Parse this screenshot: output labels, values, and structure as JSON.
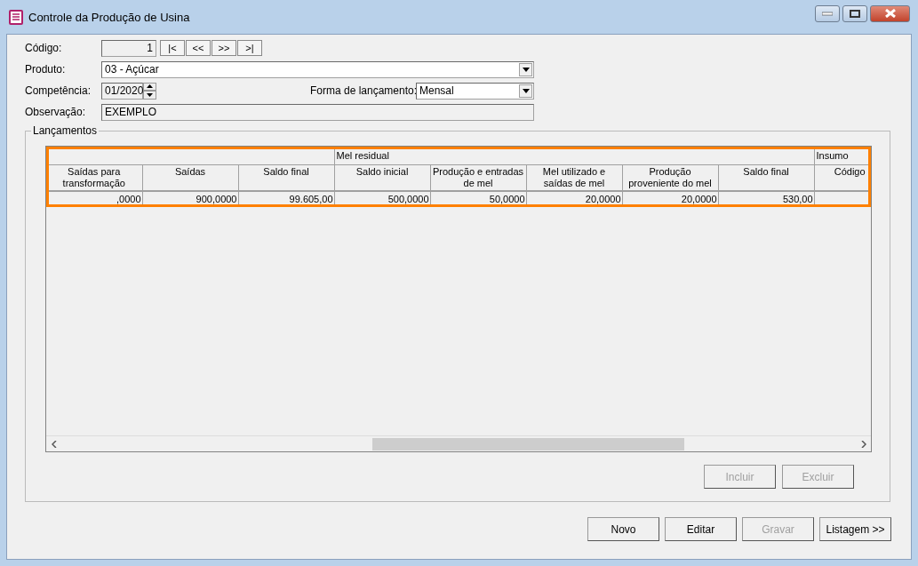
{
  "window": {
    "title": "Controle da Produção de Usina"
  },
  "form": {
    "codigo": {
      "label": "Código:",
      "value": "1",
      "nav": [
        "|<",
        "<<",
        ">>",
        ">|"
      ]
    },
    "produto": {
      "label": "Produto:",
      "value": "03 - Açúcar"
    },
    "competencia": {
      "label": "Competência:",
      "value": "01/2020"
    },
    "forma": {
      "label": "Forma de lançamento:",
      "value": "Mensal"
    },
    "observacao": {
      "label": "Observação:",
      "value": "EXEMPLO"
    }
  },
  "lancamentos": {
    "title": "Lançamentos",
    "groups": [
      {
        "label": "Mel residual"
      },
      {
        "label": "Insumo"
      }
    ],
    "columns": [
      "Saídas para transformação",
      "Saídas",
      "Saldo final",
      "Saldo inicial",
      "Produção e entradas de mel",
      "Mel utilizado e saídas de mel",
      "Produção proveniente do mel",
      "Saldo final",
      "Código"
    ],
    "rows": [
      [
        ",0000",
        "900,0000",
        "99.605,00",
        "500,0000",
        "50,0000",
        "20,0000",
        "20,0000",
        "530,00",
        ""
      ]
    ],
    "buttons": [
      {
        "label": "Incluir",
        "disabled": true
      },
      {
        "label": "Excluir",
        "disabled": true
      }
    ]
  },
  "buttons": [
    {
      "label": "Novo",
      "disabled": false
    },
    {
      "label": "Editar",
      "disabled": false
    },
    {
      "label": "Gravar",
      "disabled": true
    },
    {
      "label": "Listagem >>",
      "disabled": false
    }
  ]
}
